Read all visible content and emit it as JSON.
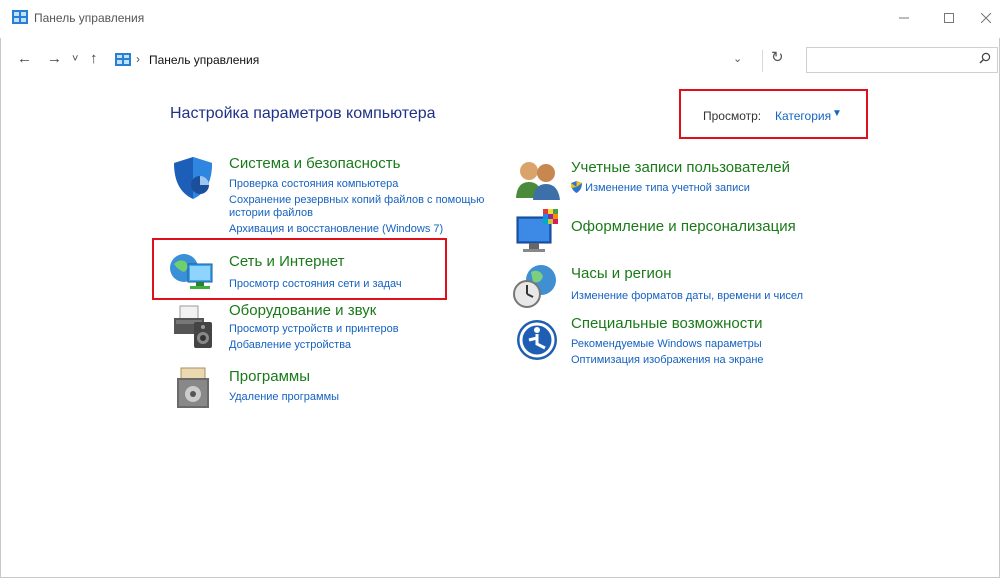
{
  "window": {
    "title": "Панель управления",
    "minimize_icon": "minimize-icon",
    "maximize_icon": "maximize-icon",
    "close_icon": "close-icon"
  },
  "nav": {
    "back": "←",
    "forward": "→",
    "recent": "˅",
    "up": "↑",
    "breadcrumb": "Панель управления",
    "breadcrumb_sep": "›",
    "dropdown": "⌄",
    "refresh": "↻",
    "search_placeholder": "",
    "search_icon": "⌕"
  },
  "main": {
    "heading": "Настройка параметров компьютера",
    "view_label": "Просмотр:",
    "view_value": "Категория",
    "view_caret": "▼"
  },
  "categories": [
    {
      "title": "Система и безопасность",
      "icon": "shield-icon",
      "links": [
        "Проверка состояния компьютера",
        "Сохранение резервных копий файлов с помощью",
        "истории файлов",
        "Архивация и восстановление (Windows 7)"
      ]
    },
    {
      "title": "Сеть и Интернет",
      "icon": "network-globe-icon",
      "links": [
        "Просмотр состояния сети и задач"
      ]
    },
    {
      "title": "Оборудование и звук",
      "icon": "printer-icon",
      "links": [
        "Просмотр устройств и принтеров",
        "Добавление устройства"
      ]
    },
    {
      "title": "Программы",
      "icon": "programs-icon",
      "links": [
        "Удаление программы"
      ]
    },
    {
      "title": "Учетные записи пользователей",
      "icon": "users-icon",
      "links": [
        "Изменение типа учетной записи"
      ]
    },
    {
      "title": "Оформление и персонализация",
      "icon": "personalization-icon",
      "links": []
    },
    {
      "title": "Часы и регион",
      "icon": "clock-globe-icon",
      "links": [
        "Изменение форматов даты, времени и чисел"
      ]
    },
    {
      "title": "Специальные возможности",
      "icon": "accessibility-icon",
      "links": [
        "Рекомендуемые Windows параметры",
        "Оптимизация изображения на экране"
      ]
    }
  ]
}
